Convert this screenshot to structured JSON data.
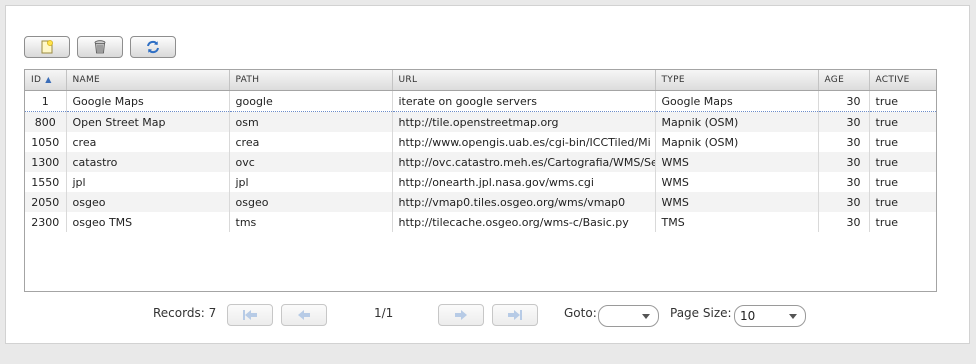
{
  "toolbar": {
    "buttons": [
      {
        "icon": "new-document-icon"
      },
      {
        "icon": "trash-bin-icon"
      },
      {
        "icon": "refresh-icon"
      }
    ]
  },
  "grid": {
    "columns": [
      "ID",
      "NAME",
      "PATH",
      "URL",
      "TYPE",
      "AGE",
      "ACTIVE"
    ],
    "sort_column": "ID",
    "sort_direction": "ascending",
    "rows": [
      [
        "1",
        "Google Maps",
        "google",
        "iterate on google servers",
        "Google Maps",
        "30",
        "true"
      ],
      [
        "800",
        "Open Street Map",
        "osm",
        "http://tile.openstreetmap.org",
        "Mapnik (OSM)",
        "30",
        "true"
      ],
      [
        "1050",
        "crea",
        "crea",
        "http://www.opengis.uab.es/cgi-bin/ICCTiled/Mi",
        "Mapnik (OSM)",
        "30",
        "true"
      ],
      [
        "1300",
        "catastro",
        "ovc",
        "http://ovc.catastro.meh.es/Cartografia/WMS/Se",
        "WMS",
        "30",
        "true"
      ],
      [
        "1550",
        "jpl",
        "jpl",
        "http://onearth.jpl.nasa.gov/wms.cgi",
        "WMS",
        "30",
        "true"
      ],
      [
        "2050",
        "osgeo",
        "osgeo",
        "http://vmap0.tiles.osgeo.org/wms/vmap0",
        "WMS",
        "30",
        "true"
      ],
      [
        "2300",
        "osgeo TMS",
        "tms",
        "http://tilecache.osgeo.org/wms-c/Basic.py",
        "TMS",
        "30",
        "true"
      ]
    ]
  },
  "pager": {
    "records_label": "Records: 7",
    "page_indicator": "1/1",
    "goto_label": "Goto:",
    "goto_value": "",
    "page_size_label": "Page Size:",
    "page_size_value": "10"
  }
}
